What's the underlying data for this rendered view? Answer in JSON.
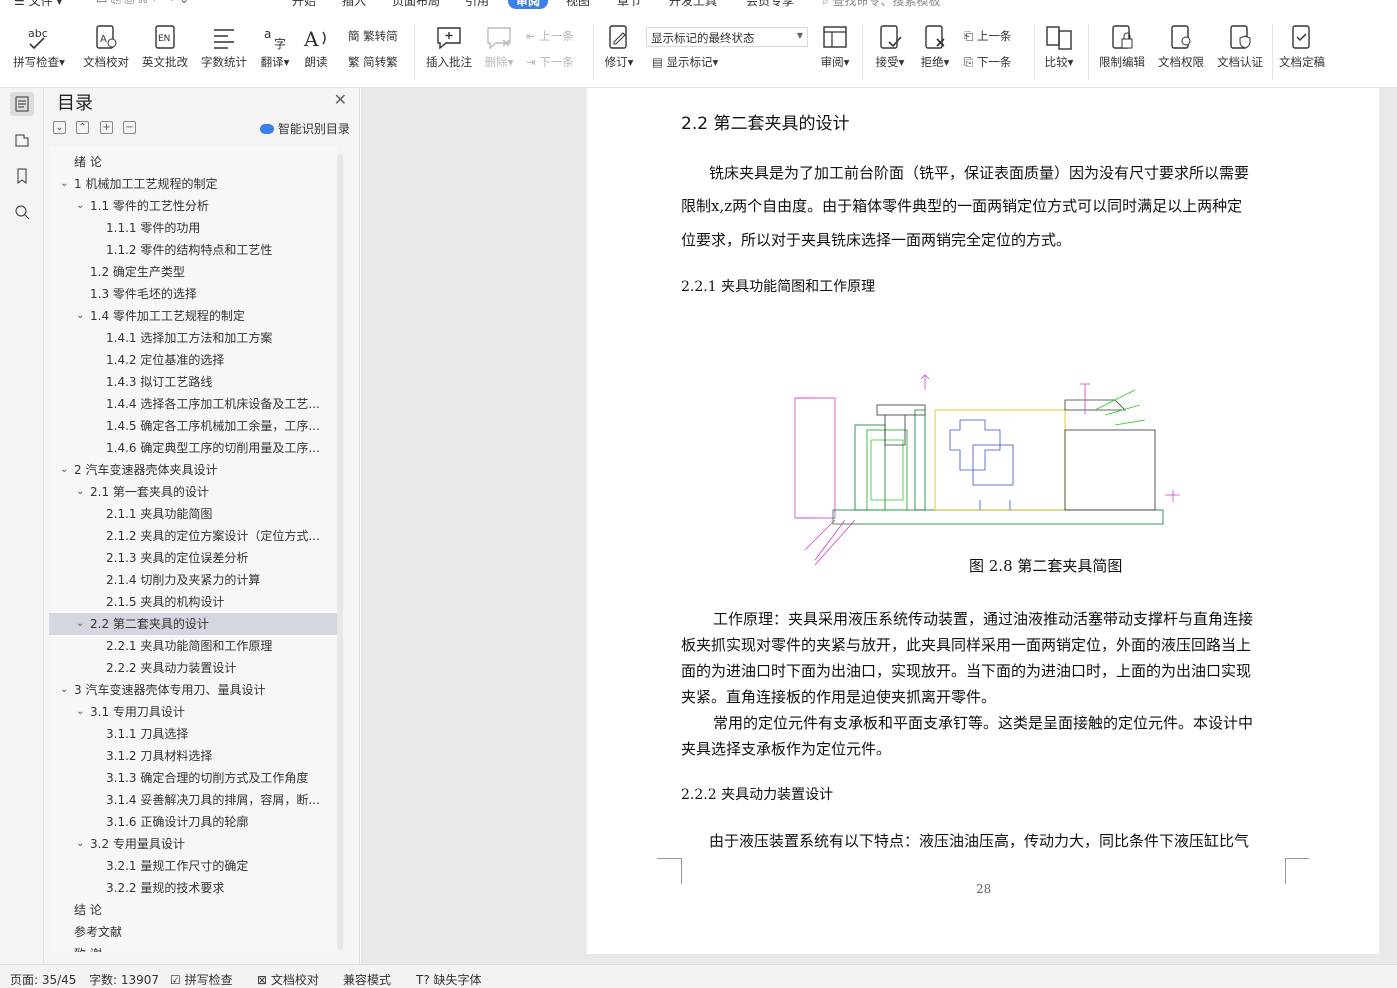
{
  "menu": {
    "file": "文件",
    "tabs": [
      "开始",
      "插入",
      "页面布局",
      "引用",
      "审阅",
      "视图",
      "章节",
      "开发工具",
      "会员专享"
    ],
    "search_placeholder": "查找命令、搜索模板"
  },
  "ribbon": {
    "spell_check": "拼写检查",
    "doc_proof": "文档校对",
    "en_revise": "英文批改",
    "word_count": "字数统计",
    "translate": "翻译",
    "read_aloud": "朗读",
    "to_traditional": "繁转简",
    "to_simplified": "简转繁",
    "insert_comment": "插入批注",
    "delete": "删除",
    "prev_comment": "上一条",
    "next_comment": "下一条",
    "track_changes": "修订",
    "markup_state": "显示标记的最终状态",
    "show_markup": "显示标记",
    "review": "审阅",
    "accept": "接受",
    "reject": "拒绝",
    "prev_change": "上一条",
    "next_change": "下一条",
    "compare": "比较",
    "restrict_edit": "限制编辑",
    "doc_permission": "文档权限",
    "doc_certify": "文档认证",
    "doc_finalize": "文档定稿"
  },
  "toc": {
    "title": "目录",
    "smart_label": "智能识别目录",
    "items": [
      {
        "text": "绪  论",
        "level": 0,
        "arrow": ""
      },
      {
        "text": "1  机械加工工艺规程的制定",
        "level": 0,
        "arrow": "down"
      },
      {
        "text": "1.1  零件的工艺性分析",
        "level": 1,
        "arrow": "down"
      },
      {
        "text": "1.1.1  零件的功用",
        "level": 2,
        "arrow": ""
      },
      {
        "text": "1.1.2  零件的结构特点和工艺性",
        "level": 2,
        "arrow": ""
      },
      {
        "text": "1.2  确定生产类型",
        "level": 1,
        "arrow": ""
      },
      {
        "text": "1.3  零件毛坯的选择",
        "level": 1,
        "arrow": ""
      },
      {
        "text": "1.4  零件加工工艺规程的制定",
        "level": 1,
        "arrow": "down"
      },
      {
        "text": "1.4.1  选择加工方法和加工方案",
        "level": 2,
        "arrow": ""
      },
      {
        "text": "1.4.2  定位基准的选择",
        "level": 2,
        "arrow": ""
      },
      {
        "text": "1.4.3  拟订工艺路线",
        "level": 2,
        "arrow": ""
      },
      {
        "text": "1.4.4  选择各工序加工机床设备及工艺...",
        "level": 2,
        "arrow": ""
      },
      {
        "text": "1.4.5  确定各工序机械加工余量，工序...",
        "level": 2,
        "arrow": ""
      },
      {
        "text": "1.4.6  确定典型工序的切削用量及工序...",
        "level": 2,
        "arrow": ""
      },
      {
        "text": "2  汽车变速器壳体夹具设计",
        "level": 0,
        "arrow": "down"
      },
      {
        "text": "2.1  第一套夹具的设计",
        "level": 1,
        "arrow": "down"
      },
      {
        "text": "2.1.1  夹具功能简图",
        "level": 2,
        "arrow": ""
      },
      {
        "text": "2.1.2  夹具的定位方案设计（定位方式...",
        "level": 2,
        "arrow": ""
      },
      {
        "text": "2.1.3  夹具的定位误差分析",
        "level": 2,
        "arrow": ""
      },
      {
        "text": "2.1.4  切削力及夹紧力的计算",
        "level": 2,
        "arrow": ""
      },
      {
        "text": "2.1.5  夹具的机构设计",
        "level": 2,
        "arrow": ""
      },
      {
        "text": "2.2  第二套夹具的设计",
        "level": 1,
        "arrow": "down",
        "selected": true
      },
      {
        "text": "2.2.1  夹具功能简图和工作原理",
        "level": 2,
        "arrow": ""
      },
      {
        "text": "2.2.2  夹具动力装置设计",
        "level": 2,
        "arrow": ""
      },
      {
        "text": "3  汽车变速器壳体专用刀、量具设计",
        "level": 0,
        "arrow": "down"
      },
      {
        "text": "3.1  专用刀具设计",
        "level": 1,
        "arrow": "down"
      },
      {
        "text": "3.1.1  刀具选择",
        "level": 2,
        "arrow": ""
      },
      {
        "text": "3.1.2  刀具材料选择",
        "level": 2,
        "arrow": ""
      },
      {
        "text": "3.1.3  确定合理的切削方式及工作角度",
        "level": 2,
        "arrow": ""
      },
      {
        "text": "3.1.4  妥善解决刀具的排屑，容屑，断...",
        "level": 2,
        "arrow": ""
      },
      {
        "text": "3.1.6  正确设计刀具的轮廓",
        "level": 2,
        "arrow": ""
      },
      {
        "text": "3.2  专用量具设计",
        "level": 1,
        "arrow": "down"
      },
      {
        "text": "3.2.1  量规工作尺寸的确定",
        "level": 2,
        "arrow": ""
      },
      {
        "text": "3.2.2  量规的技术要求",
        "level": 2,
        "arrow": ""
      },
      {
        "text": "结  论",
        "level": 0,
        "arrow": ""
      },
      {
        "text": "参考文献",
        "level": 0,
        "arrow": ""
      },
      {
        "text": "致  谢",
        "level": 0,
        "arrow": ""
      }
    ]
  },
  "document": {
    "heading_22": "2.2  第二套夹具的设计",
    "para1": [
      "铣床夹具是为了加工前台阶面（铣平，保证表面质量）因为没有尺寸要求所以需要",
      "限制x,z两个自由度。由于箱体零件典型的一面两销定位方式可以同时满足以上两种定",
      "位要求，所以对于夹具铣床选择一面两销完全定位的方式。"
    ],
    "heading_221": "2.2.1  夹具功能简图和工作原理",
    "figure_caption": "图 2.8 第二套夹具简图",
    "para2": [
      "工作原理：夹具采用液压系统传动装置，通过油液推动活塞带动支撑杆与直角连接",
      "板夹抓实现对零件的夹紧与放开，此夹具同样采用一面两销定位，外面的液压回路当上",
      "面的为进油口时下面为出油口，实现放开。当下面的为进油口时，上面的为出油口实现",
      "夹紧。直角连接板的作用是迫使夹抓离开零件。"
    ],
    "para3": [
      "常用的定位元件有支承板和平面支承钉等。这类是呈面接触的定位元件。本设计中",
      "夹具选择支承板作为定位元件。"
    ],
    "heading_222": "2.2.2  夹具动力装置设计",
    "para4": "由于液压装置系统有以下特点：液压油油压高，传动力大，同比条件下液压缸比气",
    "page_number": "28"
  },
  "status": {
    "page": "页面: 35/45",
    "words": "字数: 13907",
    "spell": "拼写检查",
    "proof": "文档校对",
    "compat": "兼容模式",
    "missing_font": "缺失字体"
  }
}
